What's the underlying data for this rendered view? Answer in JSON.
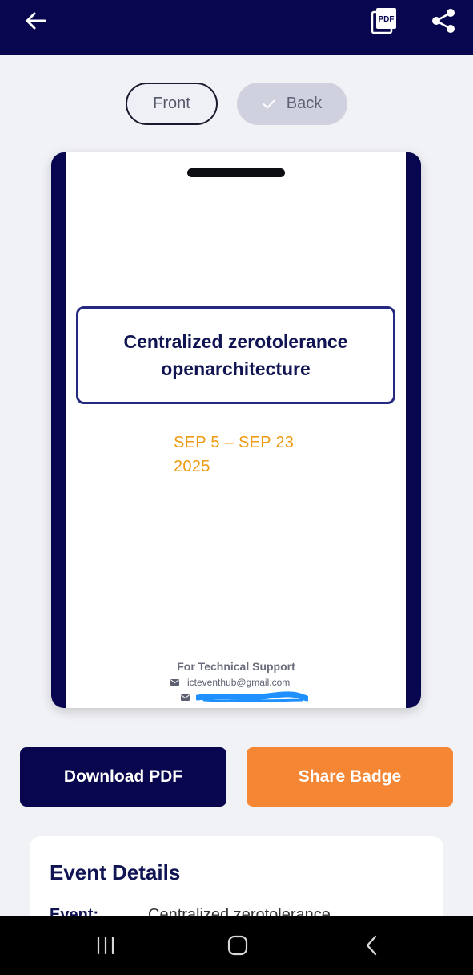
{
  "toolbar": {
    "back_icon": "arrow-left-icon",
    "pdf_icon": "pdf-icon",
    "share_icon": "share-icon"
  },
  "badge_toggle": {
    "front_label": "Front",
    "back_label": "Back",
    "selected": "Back"
  },
  "badge": {
    "title": "Centralized zerotolerance openarchitecture",
    "dates": "SEP 5 – SEP 23 2025",
    "support_heading": "For Technical Support",
    "support_email": "icteventhub@gmail.com"
  },
  "actions": {
    "download_label": "Download PDF",
    "share_label": "Share Badge"
  },
  "event_details": {
    "heading": "Event Details",
    "rows": [
      {
        "key": "Event:",
        "value": "Centralized zerotolerance"
      }
    ]
  },
  "colors": {
    "brand_navy": "#08064e",
    "accent_orange": "#f58634",
    "date_orange": "#ee9a12"
  }
}
